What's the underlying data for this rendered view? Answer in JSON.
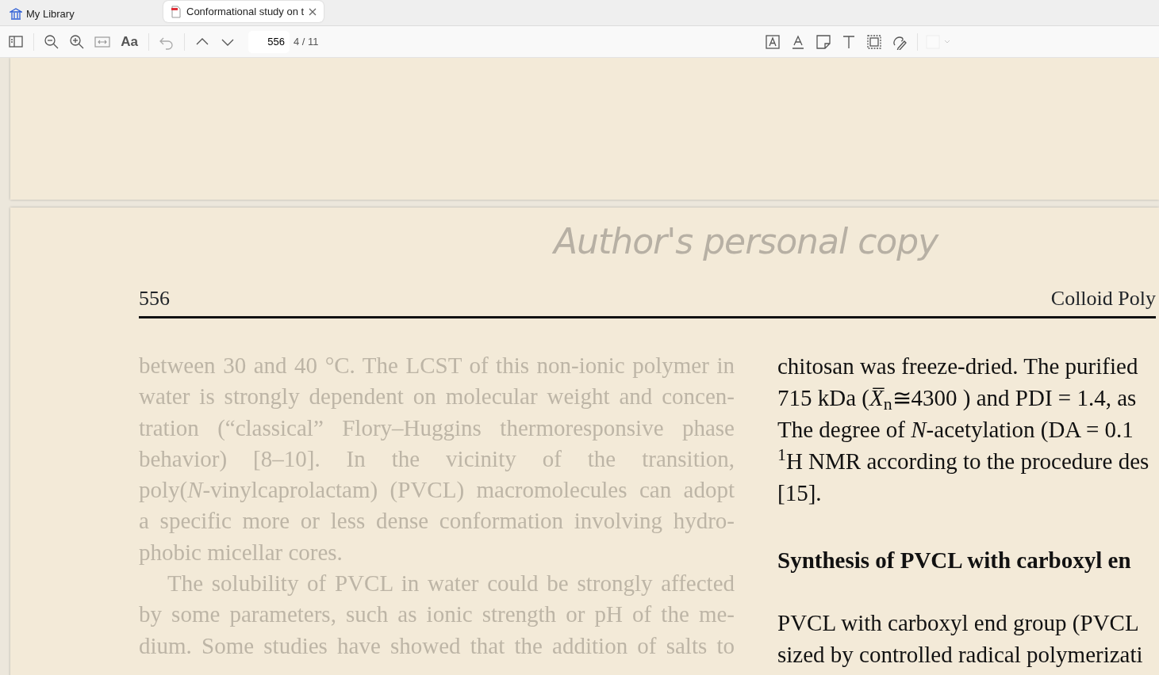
{
  "tabs": [
    {
      "kind": "library",
      "label": "My Library",
      "selected": false
    },
    {
      "kind": "document",
      "label": "Conformational study on t",
      "selected": true
    }
  ],
  "toolbar": {
    "font_button": "Aa",
    "page_input": "556",
    "page_count": "4 / 11"
  },
  "page": {
    "watermark": "Author's personal copy",
    "page_number": "556",
    "running_head": "Colloid Poly",
    "left_column": [
      [
        "between 30 and 40 °C. The LCST of this non-ionic polymer in",
        "water is strongly dependent on molecular weight and concen-",
        "tration (“classical” Flory–Huggins thermoresponsive phase",
        "behavior) [8–10]. In the vicinity of the transition,",
        "poly(*N*-vinylcaprolactam) (PVCL) macromolecules can adopt",
        "a specific more or less dense conformation involving hydro-",
        "phobic micellar cores."
      ],
      [
        "The solubility of PVCL in water could be strongly affected",
        "by some parameters, such as ionic strength or pH of the me-",
        "dium. Some studies have showed that the addition of salts to"
      ]
    ],
    "right_column": [
      {
        "kind": "paragraph",
        "lines": [
          "chitosan was freeze-dried. The purified",
          "715 kDa (*X̅*$_{n}$≅4300 ) and PDI = 1.4, as",
          "The degree of *N*-acetylation (DA = 0.1",
          "$^{1}$H NMR according to the procedure des",
          "[15]."
        ]
      },
      {
        "kind": "heading",
        "lines": [
          "Synthesis of PVCL with carboxyl en"
        ]
      },
      {
        "kind": "paragraph",
        "lines": [
          "PVCL with carboxyl end group (PVCL",
          "sized by controlled radical polymerizati"
        ]
      }
    ]
  }
}
